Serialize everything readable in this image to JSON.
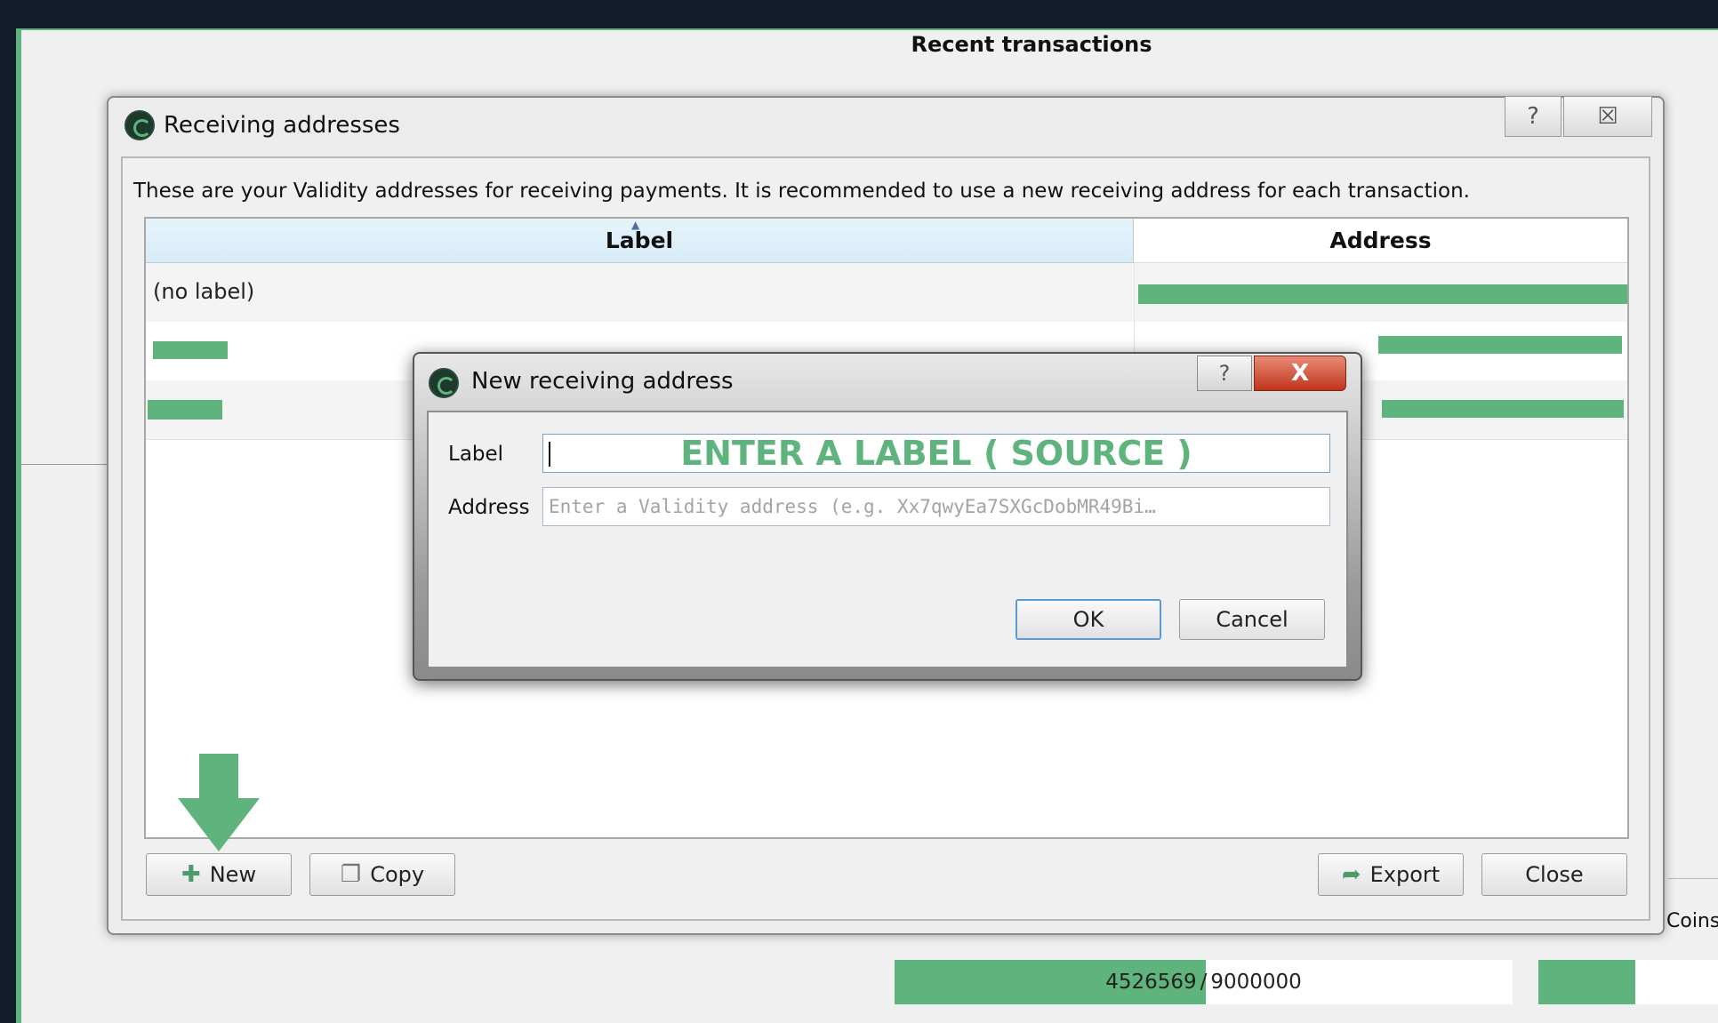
{
  "main": {
    "recent_title": "Recent transactions",
    "coins_label": "Coins",
    "progress": {
      "current": "4526569",
      "separator": "/",
      "total": "9000000",
      "fraction": 0.503
    }
  },
  "receiving_dialog": {
    "title": "Receiving addresses",
    "help_symbol": "?",
    "close_symbol": "☒",
    "description": "These are your Validity addresses for receiving payments. It is recommended to use a new receiving address for each transaction.",
    "columns": {
      "label": "Label",
      "address": "Address"
    },
    "rows": [
      {
        "label": "(no label)"
      },
      {
        "label": ""
      },
      {
        "label": ""
      }
    ],
    "buttons": {
      "new": "New",
      "copy": "Copy",
      "export": "Export",
      "close": "Close"
    }
  },
  "new_address_dialog": {
    "title": "New receiving address",
    "help_symbol": "?",
    "close_symbol": "X",
    "label_field_label": "Label",
    "label_overlay": "ENTER A LABEL ( SOURCE )",
    "address_field_label": "Address",
    "address_placeholder": "Enter a Validity address (e.g. Xx7qwyEa7SXGcDobMR49Bi…",
    "ok": "OK",
    "cancel": "Cancel"
  },
  "colors": {
    "accent": "#5fb37c",
    "titlebar_close": "#c0341b",
    "header_selected": "#d6ebf7"
  },
  "icons": {
    "app": "validity-logo-icon",
    "new": "plus-icon",
    "copy": "copy-icon",
    "export": "export-icon",
    "arrow": "down-arrow-icon"
  }
}
